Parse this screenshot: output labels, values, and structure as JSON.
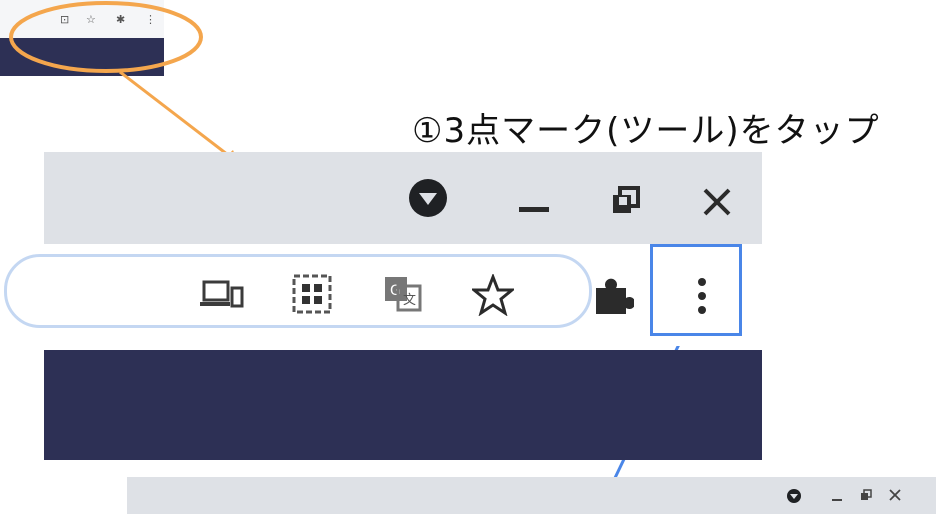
{
  "caption": "①3点マーク(ツール)をタップ",
  "colors": {
    "titlebar": "#dee1e6",
    "content": "#2d3055",
    "arrow_orange": "#f4a64d",
    "highlight_blue": "#4a86e8"
  },
  "icons": {
    "titlebar": [
      "dropdown-circle-icon",
      "minimize-icon",
      "restore-icon",
      "close-icon"
    ],
    "toolbar": [
      "cast-devices-icon",
      "qr-code-icon",
      "translate-icon",
      "star-bookmark-icon",
      "extensions-puzzle-icon",
      "three-dot-menu-icon"
    ]
  }
}
